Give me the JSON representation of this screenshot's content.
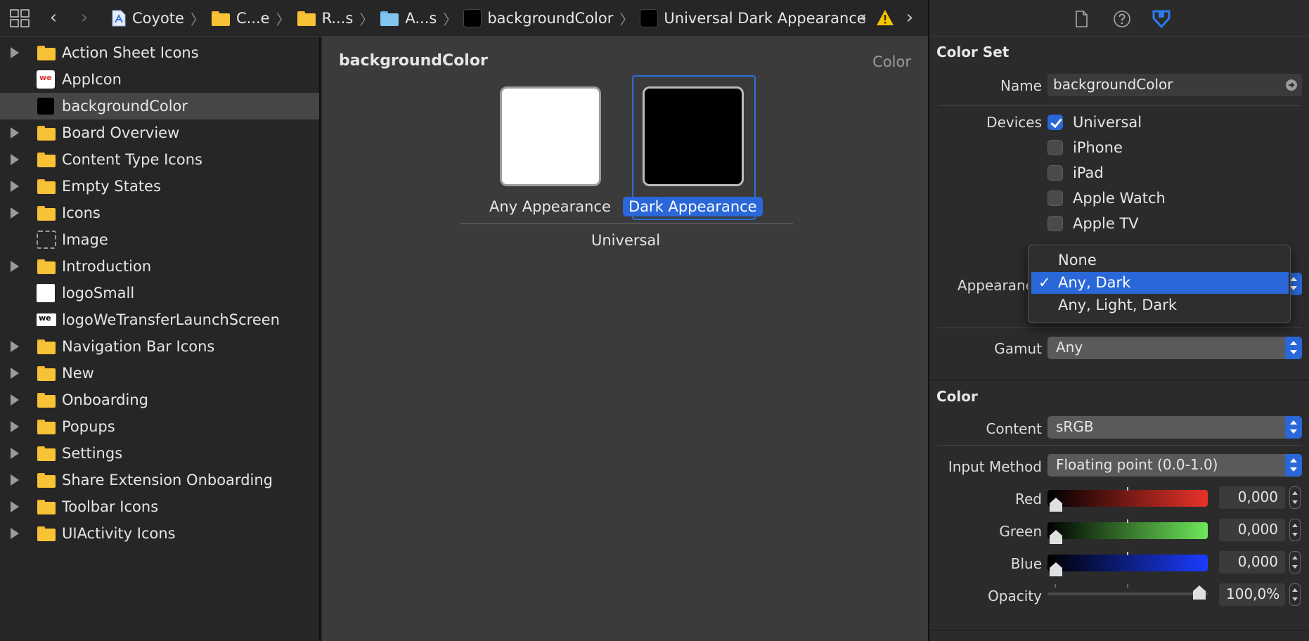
{
  "breadcrumbs": [
    {
      "label": "Coyote",
      "icon": "project-icon"
    },
    {
      "label": "C...e",
      "icon": "folder-icon"
    },
    {
      "label": "R...s",
      "icon": "folder-icon"
    },
    {
      "label": "A...s",
      "icon": "asset-catalog-icon"
    },
    {
      "label": "backgroundColor",
      "icon": "color-swatch-icon"
    },
    {
      "label": "Universal Dark Appearance",
      "icon": "color-swatch-icon"
    }
  ],
  "sidebar": {
    "items": [
      {
        "label": "Action Sheet Icons",
        "icon": "folder-icon",
        "expandable": true
      },
      {
        "label": "AppIcon",
        "icon": "app-icon",
        "expandable": false
      },
      {
        "label": "backgroundColor",
        "icon": "color-swatch-icon",
        "expandable": false,
        "selected": true
      },
      {
        "label": "Board Overview",
        "icon": "folder-icon",
        "expandable": true
      },
      {
        "label": "Content Type Icons",
        "icon": "folder-icon",
        "expandable": true
      },
      {
        "label": "Empty States",
        "icon": "folder-icon",
        "expandable": true
      },
      {
        "label": "Icons",
        "icon": "folder-icon",
        "expandable": true
      },
      {
        "label": "Image",
        "icon": "image-placeholder-icon",
        "expandable": false
      },
      {
        "label": "Introduction",
        "icon": "folder-icon",
        "expandable": true
      },
      {
        "label": "logoSmall",
        "icon": "image-icon",
        "expandable": false
      },
      {
        "label": "logoWeTransferLaunchScreen",
        "icon": "logo-image-icon",
        "expandable": false
      },
      {
        "label": "Navigation Bar Icons",
        "icon": "folder-icon",
        "expandable": true
      },
      {
        "label": "New",
        "icon": "folder-icon",
        "expandable": true
      },
      {
        "label": "Onboarding",
        "icon": "folder-icon",
        "expandable": true
      },
      {
        "label": "Popups",
        "icon": "folder-icon",
        "expandable": true
      },
      {
        "label": "Settings",
        "icon": "folder-icon",
        "expandable": true
      },
      {
        "label": "Share Extension Onboarding",
        "icon": "folder-icon",
        "expandable": true
      },
      {
        "label": "Toolbar Icons",
        "icon": "folder-icon",
        "expandable": true
      },
      {
        "label": "UIActivity Icons",
        "icon": "folder-icon",
        "expandable": true
      }
    ]
  },
  "editor": {
    "title": "backgroundColor",
    "type_label": "Color",
    "wells": [
      {
        "label": "Any Appearance",
        "color": "#ffffff",
        "selected": false
      },
      {
        "label": "Dark Appearance",
        "color": "#000000",
        "selected": true
      }
    ],
    "group_label": "Universal"
  },
  "inspector": {
    "color_set": {
      "section_title": "Color Set",
      "name_label": "Name",
      "name_value": "backgroundColor",
      "devices_label": "Devices",
      "devices": [
        {
          "label": "Universal",
          "checked": true
        },
        {
          "label": "iPhone",
          "checked": false
        },
        {
          "label": "iPad",
          "checked": false
        },
        {
          "label": "Apple Watch",
          "checked": false
        },
        {
          "label": "Apple TV",
          "checked": false
        }
      ],
      "appearances_label": "Appearance",
      "appearances_options": [
        "None",
        "Any, Dark",
        "Any, Light, Dark"
      ],
      "appearances_selected": "Any, Dark",
      "gamut_label": "Gamut",
      "gamut_value": "Any"
    },
    "color": {
      "section_title": "Color",
      "content_label": "Content",
      "content_value": "sRGB",
      "input_method_label": "Input Method",
      "input_method_value": "Floating point (0.0-1.0)",
      "channels": [
        {
          "label": "Red",
          "value": "0,000",
          "from": "#000000",
          "to": "#e8332a"
        },
        {
          "label": "Green",
          "value": "0,000",
          "from": "#000000",
          "to": "#6ee85a"
        },
        {
          "label": "Blue",
          "value": "0,000",
          "from": "#000000",
          "to": "#1a3cff"
        }
      ],
      "opacity_label": "Opacity",
      "opacity_value": "100,0%"
    }
  },
  "colors": {
    "accent": "#2a67d8",
    "folder": "#f7c236",
    "warning": "#f5c400"
  }
}
